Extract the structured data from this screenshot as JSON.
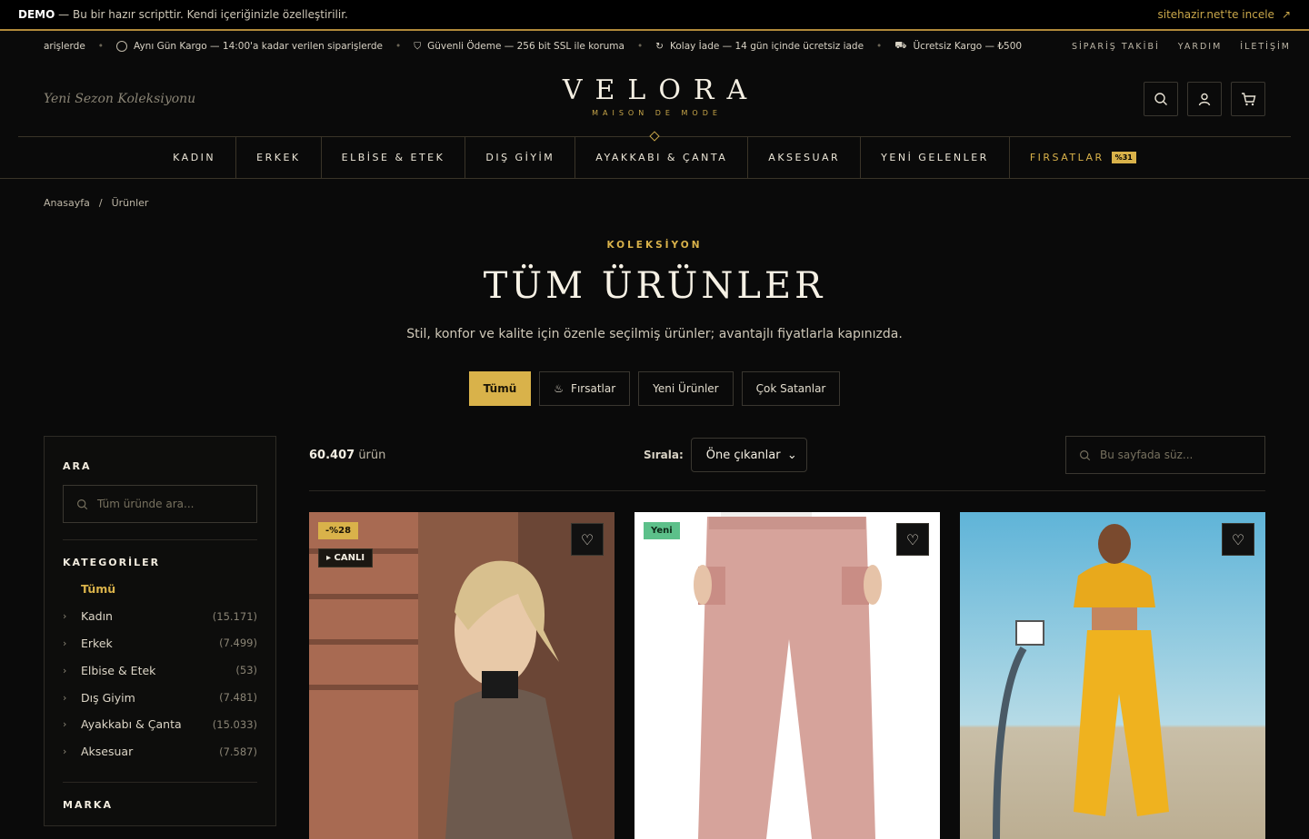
{
  "demo_bar": {
    "label": "DEMO",
    "text": "— Bu bir hazır scripttir. Kendi içeriğinizle özelleştirilir.",
    "link": "sitehazir.net'te incele"
  },
  "ticker": {
    "messages": [
      "arişlerde",
      "Aynı Gün Kargo — 14:00'a kadar verilen siparişlerde",
      "Güvenli Ödeme — 256 bit SSL ile koruma",
      "Kolay İade — 14 gün içinde ücretsiz iade",
      "Ücretsiz Kargo — ₺500"
    ],
    "links": [
      "SİPARİŞ TAKİBİ",
      "YARDIM",
      "İLETİŞİM"
    ]
  },
  "header": {
    "tagline": "Yeni Sezon Koleksiyonu",
    "logo": "VELORA",
    "logo_sub": "MAISON DE MODE"
  },
  "nav": [
    "KADIN",
    "ERKEK",
    "ELBİSE & ETEK",
    "DIŞ GİYİM",
    "AYAKKABI & ÇANTA",
    "AKSESUAR",
    "YENİ GELENLER",
    "FIRSATLAR"
  ],
  "nav_badge": "%31",
  "breadcrumb": [
    "Anasayfa",
    "/",
    "Ürünler"
  ],
  "hero": {
    "kicker": "KOLEKSİYON",
    "title": "TÜM ÜRÜNLER",
    "subtitle": "Stil, konfor ve kalite için özenle seçilmiş ürünler; avantajlı fiyatlarla kapınızda."
  },
  "filters": [
    "Tümü",
    "Fırsatlar",
    "Yeni Ürünler",
    "Çok Satanlar"
  ],
  "sidebar": {
    "search_title": "ARA",
    "search_placeholder": "Tüm üründe ara...",
    "categories_title": "KATEGORİLER",
    "all": "Tümü",
    "categories": [
      {
        "name": "Kadın",
        "count": "(15.171)"
      },
      {
        "name": "Erkek",
        "count": "(7.499)"
      },
      {
        "name": "Elbise & Etek",
        "count": "(53)"
      },
      {
        "name": "Dış Giyim",
        "count": "(7.481)"
      },
      {
        "name": "Ayakkabı & Çanta",
        "count": "(15.033)"
      },
      {
        "name": "Aksesuar",
        "count": "(7.587)"
      }
    ],
    "brand_title": "MARKA"
  },
  "toolbar": {
    "count": "60.407",
    "count_suffix": "ürün",
    "sort_label": "Sırala:",
    "sort_value": "Öne çıkanlar",
    "page_search_placeholder": "Bu sayfada süz..."
  },
  "products": [
    {
      "badge": "-%28",
      "live": "▸ CANLI"
    },
    {
      "badge": "Yeni"
    },
    {}
  ],
  "colors": {
    "accent": "#d9b24a",
    "background": "#0a0a0a",
    "new_badge": "#5cc08a"
  }
}
